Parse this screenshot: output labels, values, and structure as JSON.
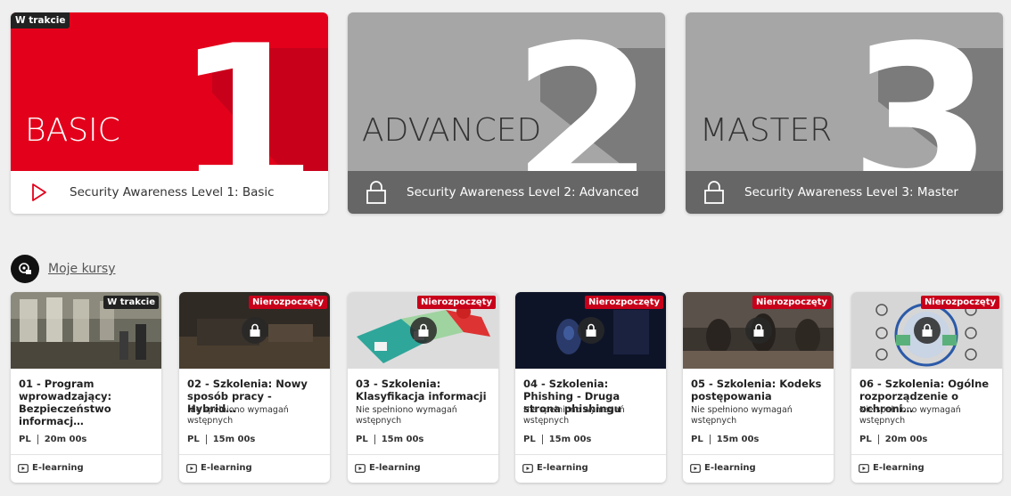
{
  "levels": [
    {
      "name": "BASIC",
      "number": "1",
      "label": "Security Awareness Level 1: Basic",
      "status": "W trakcie",
      "icon": "play-icon",
      "locked": false
    },
    {
      "name": "ADVANCED",
      "number": "2",
      "label": "Security Awareness Level 2: Advanced",
      "status": "",
      "icon": "lock-icon",
      "locked": true
    },
    {
      "name": "MASTER",
      "number": "3",
      "label": "Security Awareness Level 3: Master",
      "status": "",
      "icon": "lock-icon",
      "locked": true
    }
  ],
  "section": {
    "title": "Moje kursy",
    "icon": "courses-icon"
  },
  "courses": [
    {
      "title": "01 - Program wprowadzający: Bezpieczeństwo informacj…",
      "status": "W trakcie",
      "requirement": "",
      "lang": "PL",
      "duration": "20m 00s",
      "type": "E-learning",
      "locked": false
    },
    {
      "title": "02 - Szkolenia: Nowy sposób pracy - Hybrid…",
      "status": "Nierozpoczęty",
      "requirement": "Nie spełniono wymagań wstępnych",
      "lang": "PL",
      "duration": "15m 00s",
      "type": "E-learning",
      "locked": true
    },
    {
      "title": "03 - Szkolenia: Klasyfikacja informacji",
      "status": "Nierozpoczęty",
      "requirement": "Nie spełniono wymagań wstępnych",
      "lang": "PL",
      "duration": "15m 00s",
      "type": "E-learning",
      "locked": true
    },
    {
      "title": "04 - Szkolenia: Phishing - Druga strona phishingu",
      "status": "Nierozpoczęty",
      "requirement": "Nie spełniono wymagań wstępnych",
      "lang": "PL",
      "duration": "15m 00s",
      "type": "E-learning",
      "locked": true
    },
    {
      "title": "05 - Szkolenia: Kodeks postępowania",
      "status": "Nierozpoczęty",
      "requirement": "Nie spełniono wymagań wstępnych",
      "lang": "PL",
      "duration": "15m 00s",
      "type": "E-learning",
      "locked": true
    },
    {
      "title": "06 - Szkolenia: Ogólne rozporządzenie o ochroni…",
      "status": "Nierozpoczęty",
      "requirement": "Nie spełniono wymagań wstępnych",
      "lang": "PL",
      "duration": "20m 00s",
      "type": "E-learning",
      "locked": true
    }
  ],
  "colors": {
    "accent": "#e3001b",
    "badge_red": "#c8001a",
    "locked_banner": "#a6a6a6",
    "locked_footer": "#666666"
  }
}
